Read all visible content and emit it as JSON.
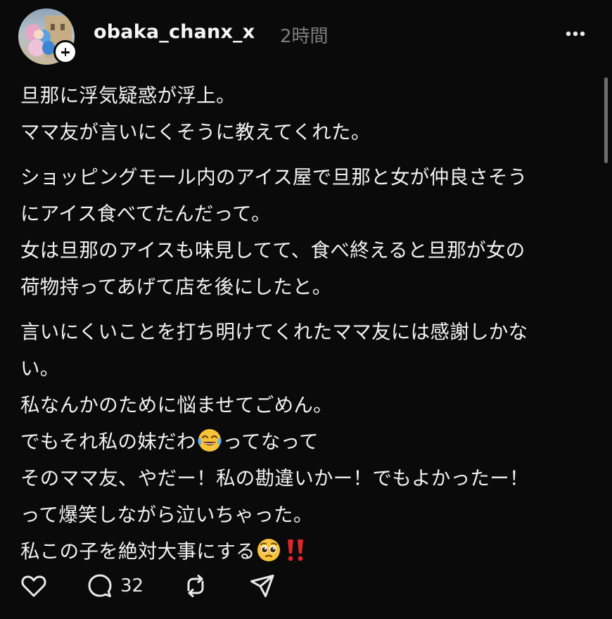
{
  "post": {
    "username": "obaka_chanx_x",
    "timestamp": "2時間",
    "paragraphs": [
      {
        "lines": [
          "旦那に浮気疑惑が浮上。",
          "ママ友が言いにくそうに教えてくれた。"
        ]
      },
      {
        "lines": [
          "ショッピングモール内のアイス屋で旦那と女が仲良さそう",
          "にアイス食べてたんだって。",
          "女は旦那のアイスも味見してて、食べ終えると旦那が女の",
          "荷物持ってあげて店を後にしたと。"
        ]
      },
      {
        "lines": [
          "言いにくいことを打ち明けてくれたママ友には感謝しかな",
          "い。",
          "私なんかのために悩ませてごめん。"
        ],
        "line_emoji_a_before": "でもそれ私の妹だわ",
        "line_emoji_a_after": "ってなって",
        "lines_after": [
          "そのママ友、やだー！私の勘違いかー！でもよかったー！",
          "って爆笑しながら泣いちゃった。"
        ],
        "line_emoji_b_before": "私この子を絶対大事にする"
      }
    ],
    "emoji": {
      "laugh_cry": "face-with-tears-of-joy-icon",
      "pleading": "pleading-face-icon",
      "exclamation": "double-exclamation-icon"
    }
  },
  "actions": {
    "reply_count": "32",
    "icons": [
      "heart-icon",
      "comment-icon",
      "repost-icon",
      "share-icon"
    ]
  },
  "colors": {
    "background": "#0a0a0a",
    "text": "#f2f2f2",
    "muted": "#7d7d7d",
    "exclamation": "#e0262b"
  }
}
